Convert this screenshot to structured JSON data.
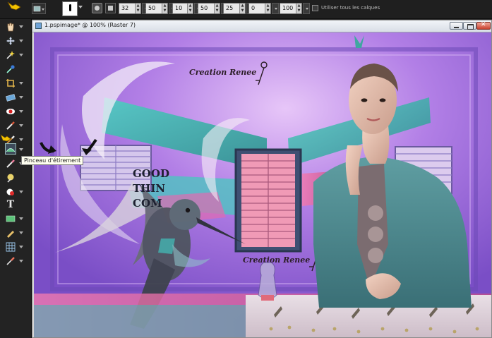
{
  "options_bar": {
    "values": [
      "32",
      "50",
      "10",
      "50",
      "25",
      "0",
      "100"
    ],
    "checkbox_label": "Utiliser tous les calques"
  },
  "document": {
    "title": "1.pspimage* @ 100% (Raster 7)"
  },
  "canvas_art": {
    "watermark_top": "Creation Renee",
    "watermark_bottom": "Creation Renee",
    "wall_text_lines": [
      "GOOD",
      "THIN",
      "COM"
    ]
  },
  "tooltip": "Pinceau d'étirement",
  "colors": {
    "ui_dark": "#232323",
    "canvas_purple": "#9a6fd6",
    "accent_teal": "#3fb9b0",
    "accent_pink": "#e86a9a"
  },
  "icons": [
    "pan-hand-icon",
    "move-icon",
    "magic-wand-icon",
    "dropper-icon",
    "crop-icon",
    "straighten-icon",
    "red-eye-icon",
    "clone-brush-icon",
    "paint-brush-icon",
    "warp-brush-icon",
    "eraser-icon",
    "dodge-icon",
    "flood-fill-icon",
    "text-icon",
    "rectangle-icon",
    "pen-icon",
    "mesh-warp-icon",
    "color-picker-icon"
  ]
}
